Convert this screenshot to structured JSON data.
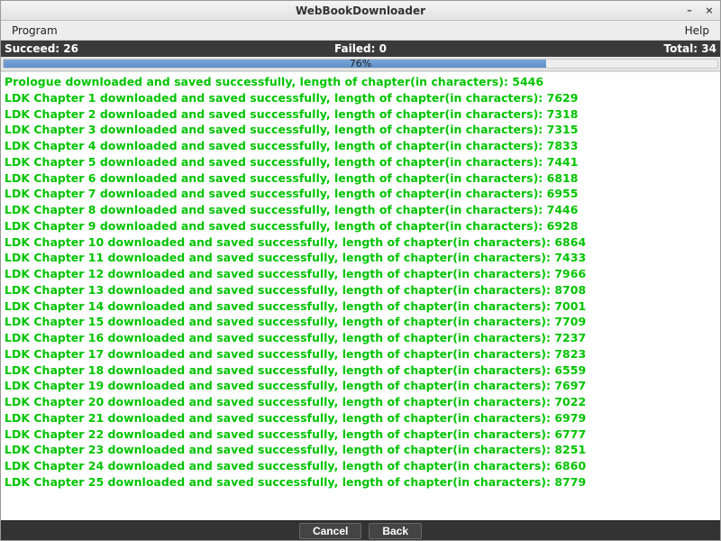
{
  "window": {
    "title": "WebBookDownloader",
    "minimize": "–",
    "close": "×"
  },
  "menu": {
    "program": "Program",
    "help": "Help"
  },
  "status": {
    "succeed_label": "Succeed: 26",
    "failed_label": "Failed: 0",
    "total_label": "Total: 34"
  },
  "progress": {
    "percent": 76,
    "percent_label": "76%"
  },
  "log": [
    "Prologue downloaded and saved successfully, length of chapter(in characters): 5446",
    "LDK Chapter 1 downloaded and saved successfully, length of chapter(in characters): 7629",
    "LDK Chapter 2 downloaded and saved successfully, length of chapter(in characters): 7318",
    "LDK Chapter 3 downloaded and saved successfully, length of chapter(in characters): 7315",
    "LDK Chapter 4 downloaded and saved successfully, length of chapter(in characters): 7833",
    "LDK Chapter 5 downloaded and saved successfully, length of chapter(in characters): 7441",
    "LDK Chapter 6 downloaded and saved successfully, length of chapter(in characters): 6818",
    "LDK Chapter 7 downloaded and saved successfully, length of chapter(in characters): 6955",
    "LDK Chapter 8 downloaded and saved successfully, length of chapter(in characters): 7446",
    "LDK Chapter 9 downloaded and saved successfully, length of chapter(in characters): 6928",
    "LDK Chapter 10 downloaded and saved successfully, length of chapter(in characters): 6864",
    "LDK Chapter 11 downloaded and saved successfully, length of chapter(in characters): 7433",
    "LDK Chapter 12 downloaded and saved successfully, length of chapter(in characters): 7966",
    "LDK Chapter 13 downloaded and saved successfully, length of chapter(in characters): 8708",
    "LDK Chapter 14 downloaded and saved successfully, length of chapter(in characters): 7001",
    "LDK Chapter 15 downloaded and saved successfully, length of chapter(in characters): 7709",
    "LDK Chapter 16 downloaded and saved successfully, length of chapter(in characters): 7237",
    "LDK Chapter 17 downloaded and saved successfully, length of chapter(in characters): 7823",
    "LDK Chapter 18 downloaded and saved successfully, length of chapter(in characters): 6559",
    "LDK Chapter 19 downloaded and saved successfully, length of chapter(in characters): 7697",
    "LDK Chapter 20 downloaded and saved successfully, length of chapter(in characters): 7022",
    "LDK Chapter 21 downloaded and saved successfully, length of chapter(in characters): 6979",
    "LDK Chapter 22 downloaded and saved successfully, length of chapter(in characters): 6777",
    "LDK Chapter 23 downloaded and saved successfully, length of chapter(in characters): 8251",
    "LDK Chapter 24 downloaded and saved successfully, length of chapter(in characters): 6860",
    "LDK Chapter 25 downloaded and saved successfully, length of chapter(in characters): 8779"
  ],
  "buttons": {
    "cancel": "Cancel",
    "back": "Back"
  }
}
